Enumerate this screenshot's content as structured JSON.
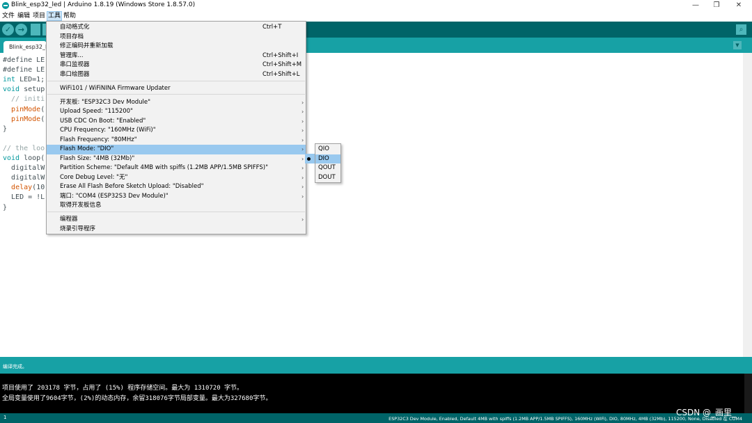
{
  "window": {
    "title": "Blink_esp32_led | Arduino 1.8.19 (Windows Store 1.8.57.0)",
    "minimize_label": "—",
    "maximize_label": "❐",
    "close_label": "✕"
  },
  "menubar": {
    "items": [
      "文件",
      "编辑",
      "项目",
      "工具",
      "帮助"
    ]
  },
  "toolbar": {
    "verify_icon": "✓",
    "upload_icon": "→",
    "serial_icon": "⌕"
  },
  "tab": {
    "name": "Blink_esp32_le",
    "menu_icon": "▼"
  },
  "editor": {
    "lines": [
      [
        "#define LE"
      ],
      [
        "#define LE"
      ],
      [
        "int",
        " LED=1;"
      ],
      [
        "void",
        " setup"
      ],
      [
        "  // initi"
      ],
      [
        "  ",
        "pinMode",
        "("
      ],
      [
        "  ",
        "pinMode",
        "("
      ],
      [
        "}"
      ],
      [
        ""
      ],
      [
        "// the loo"
      ],
      [
        "void",
        " loop("
      ],
      [
        "  ",
        "digitalW"
      ],
      [
        "  ",
        "digitalW"
      ],
      [
        "  ",
        "delay",
        "(10"
      ],
      [
        "  LED = !L"
      ],
      [
        "}"
      ]
    ]
  },
  "tools_menu": {
    "items": [
      {
        "label": "自动格式化",
        "shortcut": "Ctrl+T"
      },
      {
        "label": "项目存档"
      },
      {
        "label": "修正编码并重新加载"
      },
      {
        "label": "管理库...",
        "shortcut": "Ctrl+Shift+I"
      },
      {
        "label": "串口监视器",
        "shortcut": "Ctrl+Shift+M"
      },
      {
        "label": "串口绘图器",
        "shortcut": "Ctrl+Shift+L"
      },
      {
        "label": "WiFi101 / WiFiNINA Firmware Updater"
      },
      {
        "label": "开发板: \"ESP32C3 Dev Module\"",
        "submenu": true
      },
      {
        "label": "Upload Speed: \"115200\"",
        "submenu": true
      },
      {
        "label": "USB CDC On Boot: \"Enabled\"",
        "submenu": true
      },
      {
        "label": "CPU Frequency: \"160MHz (WiFi)\"",
        "submenu": true
      },
      {
        "label": "Flash Frequency: \"80MHz\"",
        "submenu": true
      },
      {
        "label": "Flash Mode: \"DIO\"",
        "submenu": true
      },
      {
        "label": "Flash Size: \"4MB (32Mb)\"",
        "submenu": true
      },
      {
        "label": "Partition Scheme: \"Default 4MB with spiffs (1.2MB APP/1.5MB SPIFFS)\"",
        "submenu": true
      },
      {
        "label": "Core Debug Level: \"无\"",
        "submenu": true
      },
      {
        "label": "Erase All Flash Before Sketch Upload: \"Disabled\"",
        "submenu": true
      },
      {
        "label": "端口: \"COM4 (ESP32S3 Dev Module)\"",
        "submenu": true
      },
      {
        "label": "取得开发板信息"
      },
      {
        "label": "编程器",
        "submenu": true
      },
      {
        "label": "烧录引导程序"
      }
    ],
    "arrow": "›"
  },
  "flash_mode_submenu": {
    "options": [
      "QIO",
      "DIO",
      "QOUT",
      "DOUT"
    ],
    "selected": "DIO"
  },
  "status": {
    "message": "编译完成。"
  },
  "console": {
    "lines": [
      "项目使用了 203178 字节，占用了 (15%) 程序存储空间。最大为 1310720 字节。",
      "全局变量使用了9604字节，(2%)的动态内存，余留318076字节局部变量。最大为327680字节。"
    ]
  },
  "footer": {
    "line_number": "1",
    "board_info": "ESP32C3 Dev Module, Enabled, Default 4MB with spiffs (1.2MB APP/1.5MB SPIFFS), 160MHz (WiFi), DIO, 80MHz, 4MB (32Mb), 115200, None, Disabled 在 COM4"
  },
  "watermark": "CSDN @_画里_",
  "colors": {
    "toolbar": "#006468",
    "tabbar": "#17a1a5",
    "highlight": "#99c9ef"
  }
}
